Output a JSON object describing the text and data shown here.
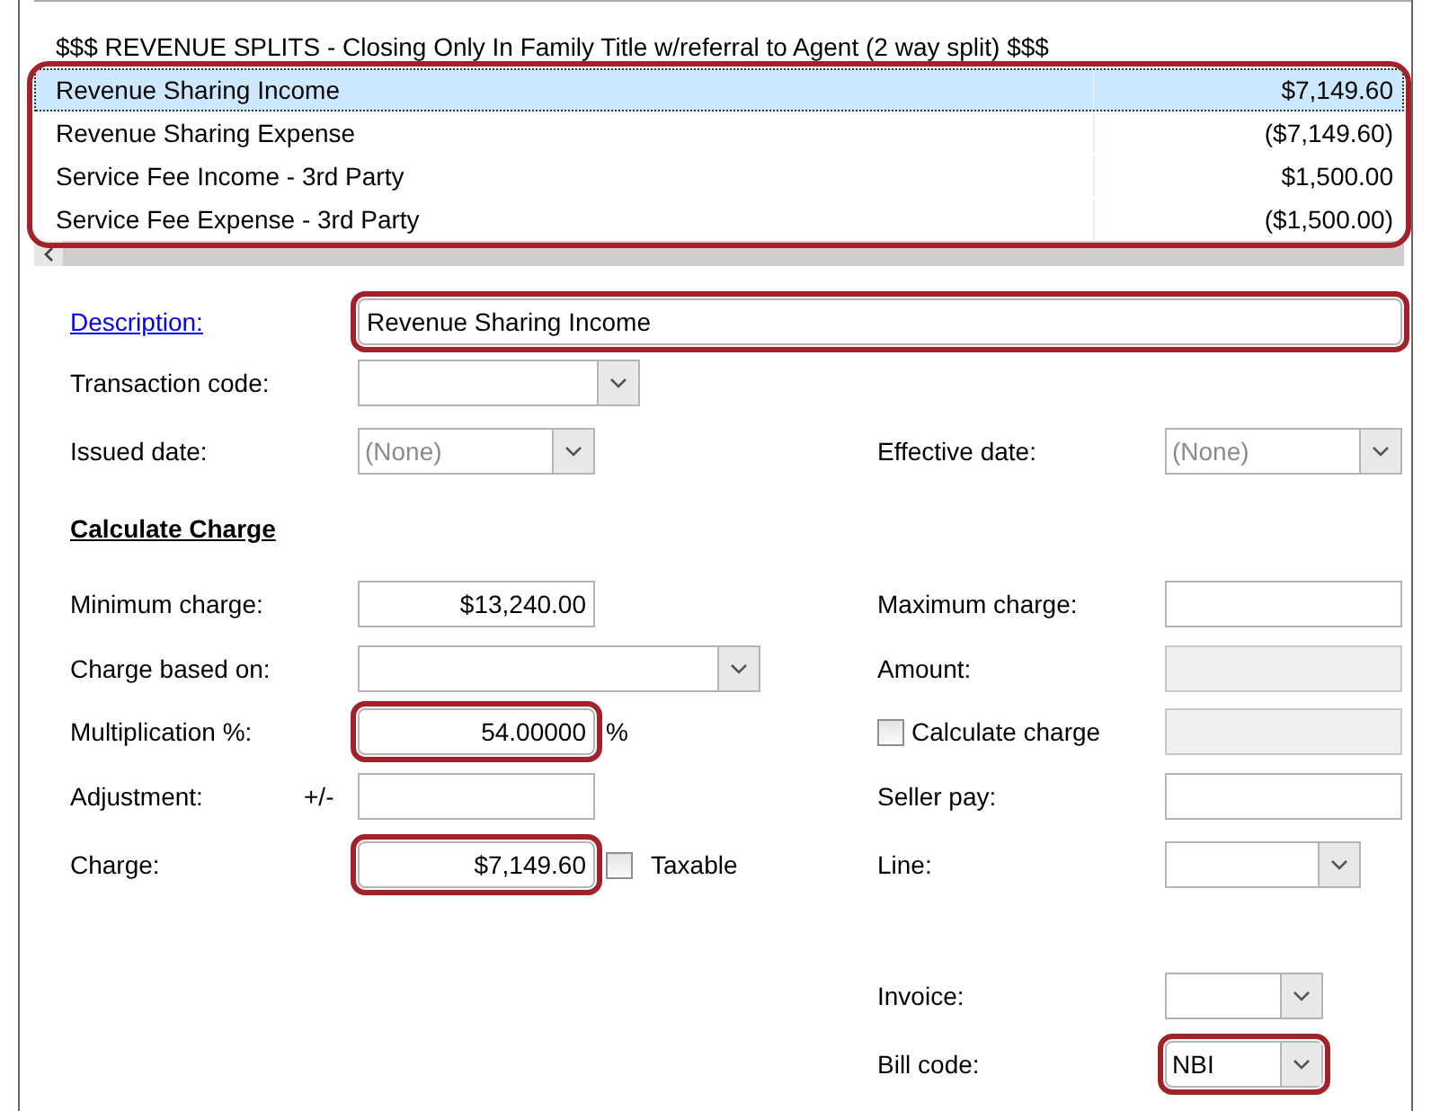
{
  "list": {
    "highlighted": true,
    "heading": "$$$ REVENUE SPLITS - Closing Only In Family Title w/referral to Agent (2 way split) $$$",
    "rows": [
      {
        "label": "Revenue Sharing Income",
        "amount": "$7,149.60",
        "selected": true
      },
      {
        "label": "Revenue Sharing Expense",
        "amount": "($7,149.60)",
        "selected": false
      },
      {
        "label": "Service Fee Income - 3rd Party",
        "amount": "$1,500.00",
        "selected": false
      },
      {
        "label": "Service Fee Expense - 3rd Party",
        "amount": "($1,500.00)",
        "selected": false
      }
    ]
  },
  "form": {
    "description": {
      "label": "Description:",
      "value": "Revenue Sharing Income",
      "highlighted": true
    },
    "transaction_code": {
      "label": "Transaction code:"
    },
    "issued_date": {
      "label": "Issued date:",
      "value": "(None)",
      "disabled": true
    },
    "effective_date": {
      "label": "Effective date:",
      "value": "(None)",
      "disabled": true
    },
    "calculate_charge_title": "Calculate Charge",
    "minimum_charge": {
      "label": "Minimum charge:",
      "value": "$13,240.00"
    },
    "maximum_charge": {
      "label": "Maximum charge:"
    },
    "charge_based_on": {
      "label": "Charge based on:"
    },
    "amount": {
      "label": "Amount:",
      "disabled": true
    },
    "multiplication": {
      "label": "Multiplication %:",
      "value": "54.00000",
      "suffix": "%",
      "highlighted": true
    },
    "calculate_charge": {
      "label": "Calculate charge",
      "checked": false,
      "disabled": true
    },
    "adjustment": {
      "label": "Adjustment:",
      "prefix": "+/-"
    },
    "seller_pay": {
      "label": "Seller pay:"
    },
    "charge": {
      "label": "Charge:",
      "value": "$7,149.60",
      "highlighted": true
    },
    "taxable": {
      "label": "Taxable",
      "checked": false
    },
    "line": {
      "label": "Line:"
    },
    "invoice": {
      "label": "Invoice:"
    },
    "bill_code": {
      "label": "Bill code:",
      "value": "NBI",
      "highlighted": true
    }
  }
}
